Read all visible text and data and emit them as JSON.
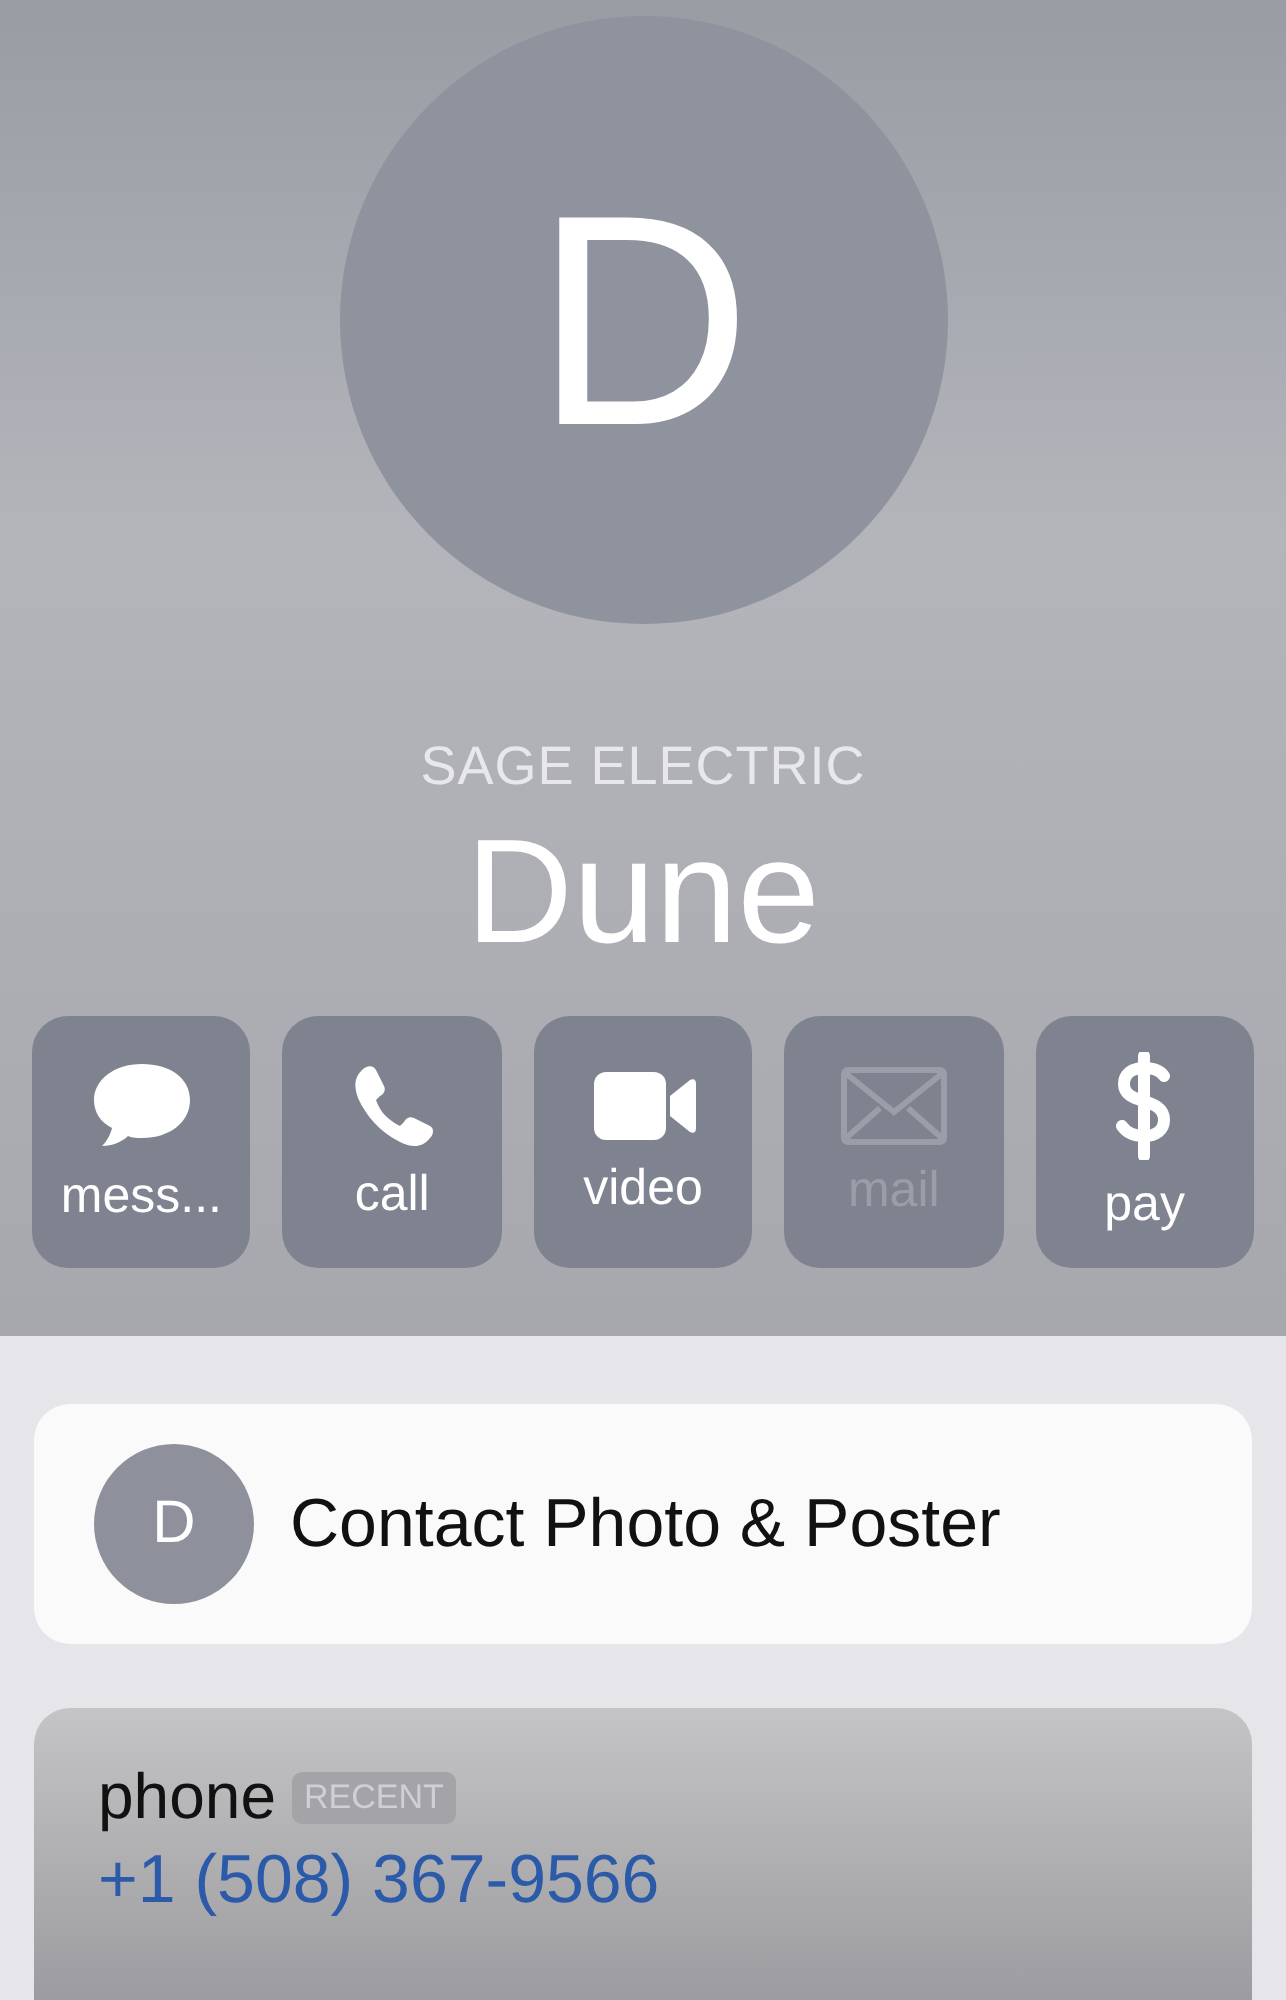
{
  "avatar": {
    "initial": "D"
  },
  "company": "SAGE ELECTRIC",
  "name": "Dune",
  "actions": [
    {
      "kind": "message",
      "label": "mess...",
      "disabled": false
    },
    {
      "kind": "call",
      "label": "call",
      "disabled": false
    },
    {
      "kind": "video",
      "label": "video",
      "disabled": false
    },
    {
      "kind": "mail",
      "label": "mail",
      "disabled": true
    },
    {
      "kind": "pay",
      "label": "pay",
      "disabled": false
    }
  ],
  "poster_card": {
    "initial": "D",
    "label": "Contact Photo & Poster"
  },
  "phone_card": {
    "label": "phone",
    "badge": "RECENT",
    "number": "+1 (508) 367-9566"
  }
}
